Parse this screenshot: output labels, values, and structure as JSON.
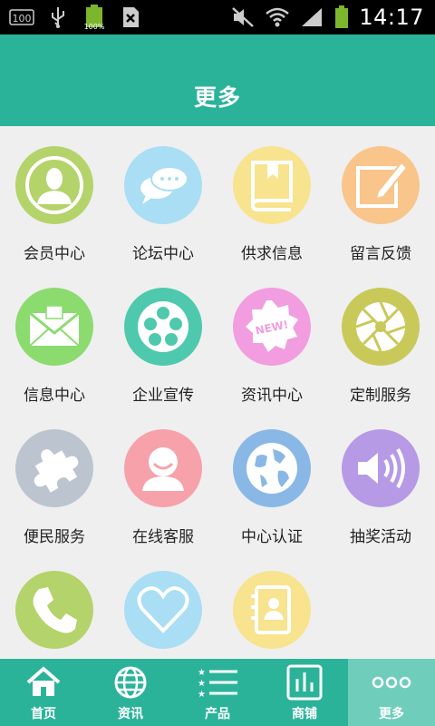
{
  "status_bar": {
    "time": "14:17",
    "battery_percent_label": "100%",
    "storage_label": "100",
    "icons": [
      "storage-icon",
      "usb-icon",
      "battery-charging-icon",
      "sim-icon",
      "mute-icon",
      "wifi-icon",
      "signal-icon",
      "battery-icon"
    ]
  },
  "header": {
    "title": "更多"
  },
  "grid": {
    "items": [
      {
        "label": "会员中心",
        "icon": "member-avatar-icon",
        "color": "#b4d36a"
      },
      {
        "label": "论坛中心",
        "icon": "chat-bubbles-icon",
        "color": "#a9def4"
      },
      {
        "label": "供求信息",
        "icon": "book-icon",
        "color": "#f8e38e"
      },
      {
        "label": "留言反馈",
        "icon": "edit-note-icon",
        "color": "#f9c58a"
      },
      {
        "label": "信息中心",
        "icon": "envelope-icon",
        "color": "#8bdb6f"
      },
      {
        "label": "企业宣传",
        "icon": "film-reel-icon",
        "color": "#4ec9ad"
      },
      {
        "label": "资讯中心",
        "icon": "new-badge-icon",
        "color": "#f29de0"
      },
      {
        "label": "定制服务",
        "icon": "aperture-icon",
        "color": "#c9c95a"
      },
      {
        "label": "便民服务",
        "icon": "puzzle-icon",
        "color": "#bcc4cf"
      },
      {
        "label": "在线客服",
        "icon": "support-person-icon",
        "color": "#f7a1aa"
      },
      {
        "label": "中心认证",
        "icon": "globe-icon",
        "color": "#8ab8e6"
      },
      {
        "label": "抽奖活动",
        "icon": "speaker-icon",
        "color": "#b69ae6"
      },
      {
        "label": "",
        "icon": "phone-icon",
        "color": "#b4d36a"
      },
      {
        "label": "",
        "icon": "heart-icon",
        "color": "#a9def4"
      },
      {
        "label": "",
        "icon": "contacts-icon",
        "color": "#f8e38e"
      }
    ]
  },
  "tabbar": {
    "tabs": [
      {
        "label": "首页",
        "icon": "home-icon",
        "active": false
      },
      {
        "label": "资讯",
        "icon": "globe-icon",
        "active": false
      },
      {
        "label": "产品",
        "icon": "list-icon",
        "active": false
      },
      {
        "label": "商铺",
        "icon": "chart-icon",
        "active": false
      },
      {
        "label": "更多",
        "icon": "more-icon",
        "active": true
      }
    ]
  },
  "colors": {
    "brand": "#2bb39a",
    "active_tab": "#6fcebb",
    "background": "#efefef"
  }
}
